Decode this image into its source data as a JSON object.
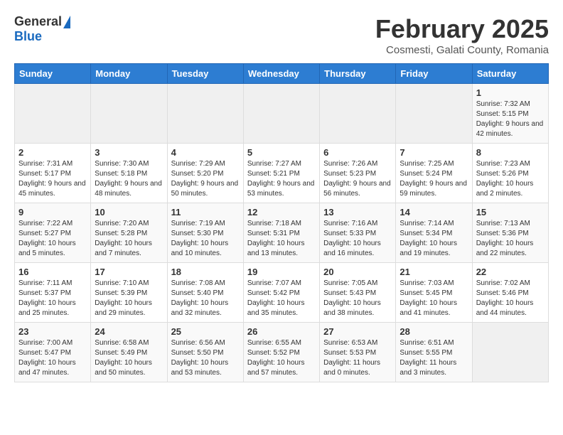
{
  "header": {
    "logo_general": "General",
    "logo_blue": "Blue",
    "title": "February 2025",
    "subtitle": "Cosmesti, Galati County, Romania"
  },
  "days_of_week": [
    "Sunday",
    "Monday",
    "Tuesday",
    "Wednesday",
    "Thursday",
    "Friday",
    "Saturday"
  ],
  "weeks": [
    [
      {
        "day": "",
        "info": ""
      },
      {
        "day": "",
        "info": ""
      },
      {
        "day": "",
        "info": ""
      },
      {
        "day": "",
        "info": ""
      },
      {
        "day": "",
        "info": ""
      },
      {
        "day": "",
        "info": ""
      },
      {
        "day": "1",
        "info": "Sunrise: 7:32 AM\nSunset: 5:15 PM\nDaylight: 9 hours and 42 minutes."
      }
    ],
    [
      {
        "day": "2",
        "info": "Sunrise: 7:31 AM\nSunset: 5:17 PM\nDaylight: 9 hours and 45 minutes."
      },
      {
        "day": "3",
        "info": "Sunrise: 7:30 AM\nSunset: 5:18 PM\nDaylight: 9 hours and 48 minutes."
      },
      {
        "day": "4",
        "info": "Sunrise: 7:29 AM\nSunset: 5:20 PM\nDaylight: 9 hours and 50 minutes."
      },
      {
        "day": "5",
        "info": "Sunrise: 7:27 AM\nSunset: 5:21 PM\nDaylight: 9 hours and 53 minutes."
      },
      {
        "day": "6",
        "info": "Sunrise: 7:26 AM\nSunset: 5:23 PM\nDaylight: 9 hours and 56 minutes."
      },
      {
        "day": "7",
        "info": "Sunrise: 7:25 AM\nSunset: 5:24 PM\nDaylight: 9 hours and 59 minutes."
      },
      {
        "day": "8",
        "info": "Sunrise: 7:23 AM\nSunset: 5:26 PM\nDaylight: 10 hours and 2 minutes."
      }
    ],
    [
      {
        "day": "9",
        "info": "Sunrise: 7:22 AM\nSunset: 5:27 PM\nDaylight: 10 hours and 5 minutes."
      },
      {
        "day": "10",
        "info": "Sunrise: 7:20 AM\nSunset: 5:28 PM\nDaylight: 10 hours and 7 minutes."
      },
      {
        "day": "11",
        "info": "Sunrise: 7:19 AM\nSunset: 5:30 PM\nDaylight: 10 hours and 10 minutes."
      },
      {
        "day": "12",
        "info": "Sunrise: 7:18 AM\nSunset: 5:31 PM\nDaylight: 10 hours and 13 minutes."
      },
      {
        "day": "13",
        "info": "Sunrise: 7:16 AM\nSunset: 5:33 PM\nDaylight: 10 hours and 16 minutes."
      },
      {
        "day": "14",
        "info": "Sunrise: 7:14 AM\nSunset: 5:34 PM\nDaylight: 10 hours and 19 minutes."
      },
      {
        "day": "15",
        "info": "Sunrise: 7:13 AM\nSunset: 5:36 PM\nDaylight: 10 hours and 22 minutes."
      }
    ],
    [
      {
        "day": "16",
        "info": "Sunrise: 7:11 AM\nSunset: 5:37 PM\nDaylight: 10 hours and 25 minutes."
      },
      {
        "day": "17",
        "info": "Sunrise: 7:10 AM\nSunset: 5:39 PM\nDaylight: 10 hours and 29 minutes."
      },
      {
        "day": "18",
        "info": "Sunrise: 7:08 AM\nSunset: 5:40 PM\nDaylight: 10 hours and 32 minutes."
      },
      {
        "day": "19",
        "info": "Sunrise: 7:07 AM\nSunset: 5:42 PM\nDaylight: 10 hours and 35 minutes."
      },
      {
        "day": "20",
        "info": "Sunrise: 7:05 AM\nSunset: 5:43 PM\nDaylight: 10 hours and 38 minutes."
      },
      {
        "day": "21",
        "info": "Sunrise: 7:03 AM\nSunset: 5:45 PM\nDaylight: 10 hours and 41 minutes."
      },
      {
        "day": "22",
        "info": "Sunrise: 7:02 AM\nSunset: 5:46 PM\nDaylight: 10 hours and 44 minutes."
      }
    ],
    [
      {
        "day": "23",
        "info": "Sunrise: 7:00 AM\nSunset: 5:47 PM\nDaylight: 10 hours and 47 minutes."
      },
      {
        "day": "24",
        "info": "Sunrise: 6:58 AM\nSunset: 5:49 PM\nDaylight: 10 hours and 50 minutes."
      },
      {
        "day": "25",
        "info": "Sunrise: 6:56 AM\nSunset: 5:50 PM\nDaylight: 10 hours and 53 minutes."
      },
      {
        "day": "26",
        "info": "Sunrise: 6:55 AM\nSunset: 5:52 PM\nDaylight: 10 hours and 57 minutes."
      },
      {
        "day": "27",
        "info": "Sunrise: 6:53 AM\nSunset: 5:53 PM\nDaylight: 11 hours and 0 minutes."
      },
      {
        "day": "28",
        "info": "Sunrise: 6:51 AM\nSunset: 5:55 PM\nDaylight: 11 hours and 3 minutes."
      },
      {
        "day": "",
        "info": ""
      }
    ]
  ]
}
